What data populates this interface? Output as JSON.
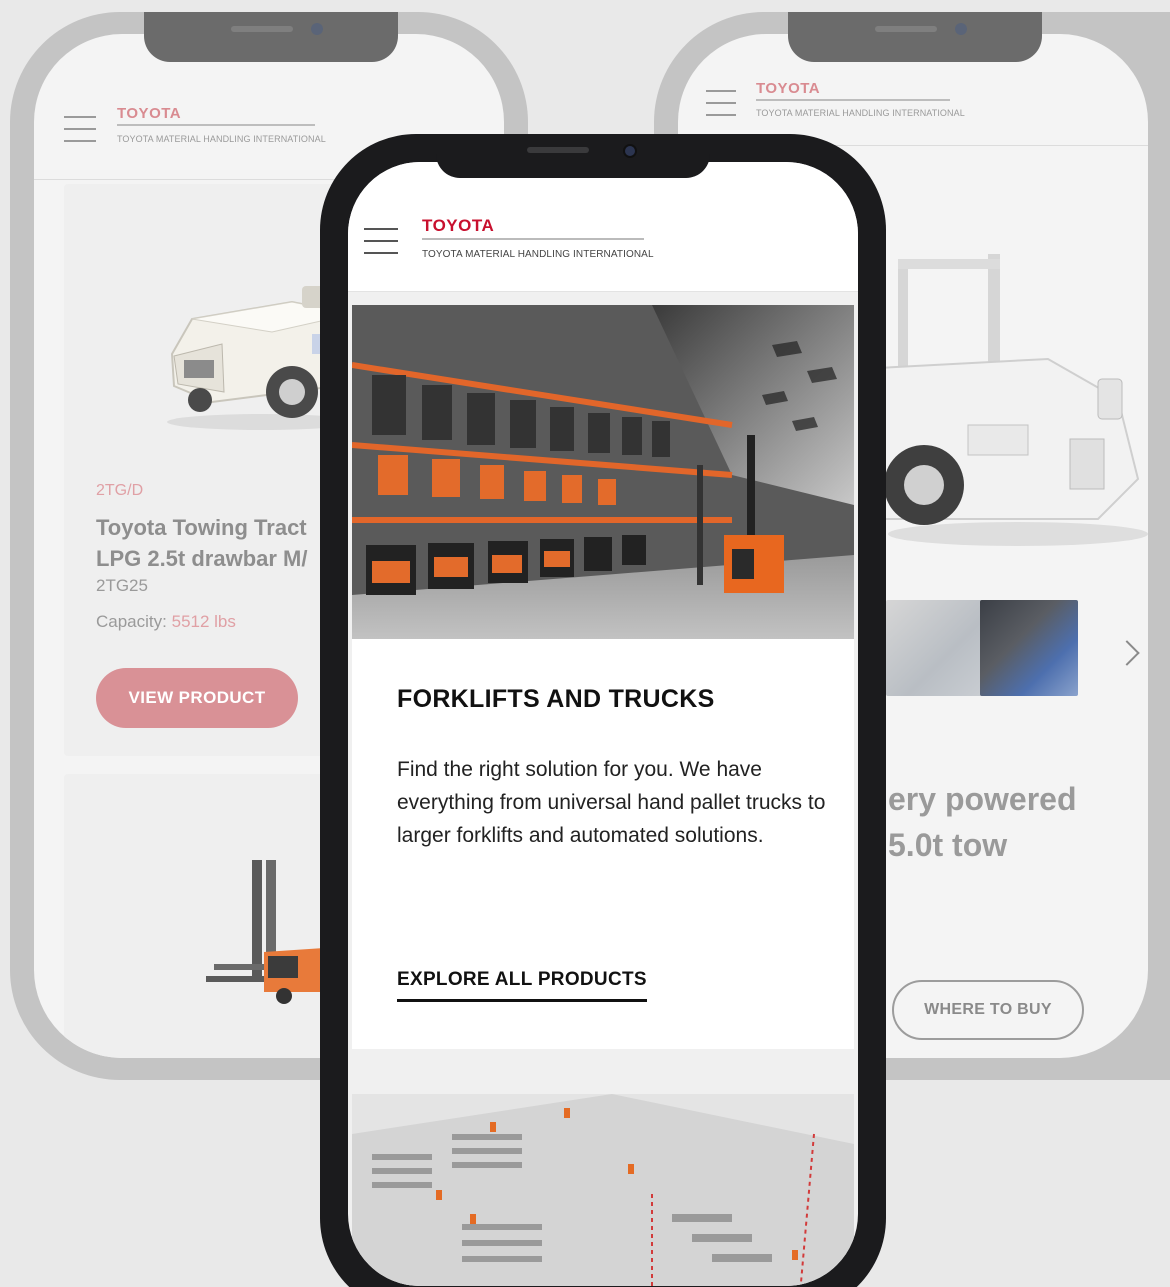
{
  "brand": {
    "name": "TOYOTA",
    "subtitle": "TOYOTA MATERIAL HANDLING INTERNATIONAL",
    "accent_color": "#c8102e"
  },
  "left_phone": {
    "product_code": "2TG/D",
    "product_name_line1": "Toyota Towing Tract",
    "product_name_line2": "LPG 2.5t drawbar M/",
    "model": "2TG25",
    "capacity_label": "Capacity:",
    "capacity_value": "5512 lbs",
    "view_button": "VIEW PRODUCT"
  },
  "right_phone": {
    "title_line1": "ery powered",
    "title_line2": "5.0t tow",
    "where_button": "WHERE TO BUY",
    "next_icon": "chevron-right-icon"
  },
  "front_phone": {
    "card_title": "FORKLIFTS AND TRUCKS",
    "card_description": "Find the right solution for you. We have everything from universal hand pallet trucks to larger forklifts and automated solutions.",
    "explore_link": "EXPLORE ALL PRODUCTS",
    "menu_icon": "hamburger-menu-icon"
  }
}
